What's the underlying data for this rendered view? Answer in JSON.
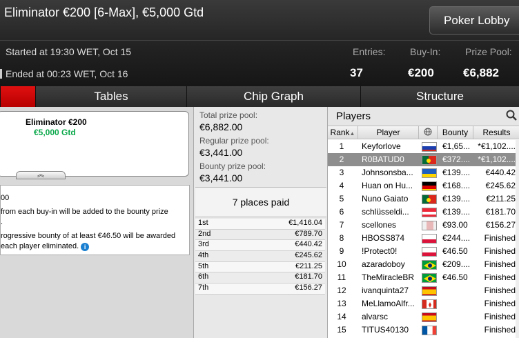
{
  "header": {
    "title": "Eliminator €200 [6-Max], €5,000 Gtd",
    "lobby_button": "Poker Lobby",
    "started": "Started at 19:30 WET, Oct 15",
    "ended": "Ended at 00:23 WET, Oct 16",
    "entries_label": "Entries:",
    "entries_value": "37",
    "buyin_label": "Buy-In:",
    "buyin_value": "€200",
    "prizepool_label": "Prize Pool:",
    "prizepool_value": "€6,882"
  },
  "tabs": [
    {
      "label": ""
    },
    {
      "label": "Tables"
    },
    {
      "label": "Chip Graph"
    },
    {
      "label": "Structure"
    }
  ],
  "ticket": {
    "name": "Eliminator €200",
    "gtd": "€5,000 Gtd"
  },
  "description": {
    "line1": "00",
    "line2": "from each buy-in will be added to the bounty prize",
    "line3": ".",
    "line4": "rogressive bounty of at least €46.50 will be awarded",
    "line5": "each player eliminated."
  },
  "prize_pool": {
    "total_label": "Total prize pool:",
    "total_value": "€6,882.00",
    "regular_label": "Regular prize pool:",
    "regular_value": "€3,441.00",
    "bounty_label": "Bounty prize pool:",
    "bounty_value": "€3,441.00",
    "places_paid": "7 places paid",
    "payouts": [
      {
        "place": "1st",
        "amount": "€1,416.04"
      },
      {
        "place": "2nd",
        "amount": "€789.70"
      },
      {
        "place": "3rd",
        "amount": "€440.42"
      },
      {
        "place": "4th",
        "amount": "€245.62"
      },
      {
        "place": "5th",
        "amount": "€211.25"
      },
      {
        "place": "6th",
        "amount": "€181.70"
      },
      {
        "place": "7th",
        "amount": "€156.27"
      }
    ]
  },
  "players": {
    "title": "Players",
    "columns": {
      "rank": "Rank",
      "player": "Player",
      "bounty": "Bounty",
      "results": "Results"
    },
    "rows": [
      {
        "rank": "1",
        "name": "Keyforlove",
        "flag": "flag-russia",
        "bounty": "€1,65...",
        "result": "*€1,102...."
      },
      {
        "rank": "2",
        "name": "R0BATUD0",
        "flag": "flag-portugal",
        "bounty": "€372....",
        "result": "*€1,102...."
      },
      {
        "rank": "3",
        "name": "Johnsonsba...",
        "flag": "flag-ukraine",
        "bounty": "€139....",
        "result": "€440.42"
      },
      {
        "rank": "4",
        "name": "Huan on Hu...",
        "flag": "flag-germany",
        "bounty": "€168....",
        "result": "€245.62"
      },
      {
        "rank": "5",
        "name": "Nuno Gaiato",
        "flag": "flag-portugal",
        "bounty": "€139....",
        "result": "€211.25"
      },
      {
        "rank": "6",
        "name": "schlüsseldi...",
        "flag": "flag-austria",
        "bounty": "€139....",
        "result": "€181.70"
      },
      {
        "rank": "7",
        "name": "scellones",
        "flag": "flag-generic",
        "bounty": "€93.00",
        "result": "€156.27"
      },
      {
        "rank": "8",
        "name": "HBOSS874",
        "flag": "flag-poland",
        "bounty": "€244....",
        "result": "Finished"
      },
      {
        "rank": "9",
        "name": "!Protect0!",
        "flag": "flag-poland",
        "bounty": "€46.50",
        "result": "Finished"
      },
      {
        "rank": "10",
        "name": "azaradoboy",
        "flag": "flag-brazil",
        "bounty": "€209....",
        "result": "Finished"
      },
      {
        "rank": "11",
        "name": "TheMiracleBR",
        "flag": "flag-brazil",
        "bounty": "€46.50",
        "result": "Finished"
      },
      {
        "rank": "12",
        "name": "ivanquinta27",
        "flag": "flag-spain",
        "bounty": "",
        "result": "Finished"
      },
      {
        "rank": "13",
        "name": "MeLlamoAlfr...",
        "flag": "flag-canada",
        "bounty": "",
        "result": "Finished"
      },
      {
        "rank": "14",
        "name": "alvarsc",
        "flag": "flag-spain",
        "bounty": "",
        "result": "Finished"
      },
      {
        "rank": "15",
        "name": "TITUS40130",
        "flag": "flag-france",
        "bounty": "",
        "result": "Finished"
      }
    ]
  }
}
